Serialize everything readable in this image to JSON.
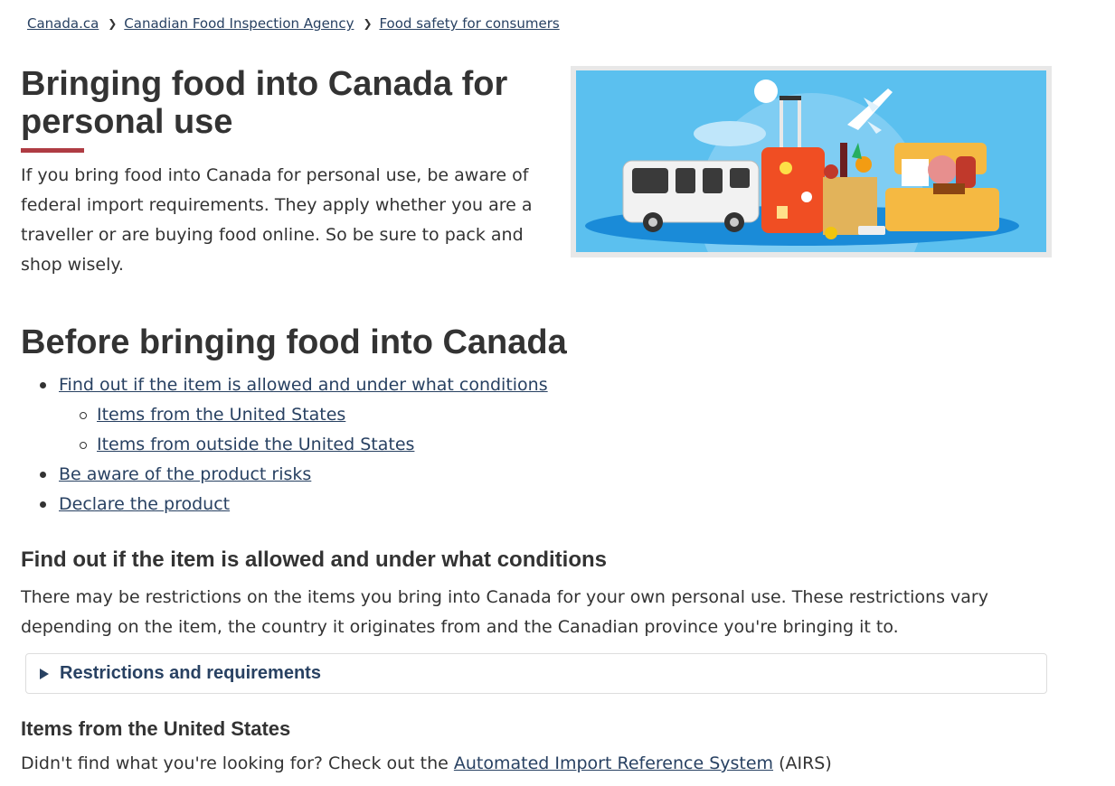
{
  "breadcrumb": [
    {
      "label": "Canada.ca"
    },
    {
      "label": "Canadian Food Inspection Agency"
    },
    {
      "label": "Food safety for consumers"
    }
  ],
  "intro": {
    "title": "Bringing food into Canada for personal use",
    "text": "If you bring food into Canada for personal use, be aware of federal import requirements. They apply whether you are a traveller or are buying food online. So be sure to pack and shop wisely.",
    "accent_color": "#af3c43"
  },
  "before": {
    "heading": "Before bringing food into Canada",
    "links": {
      "allowed": "Find out if the item is allowed and under what conditions",
      "us": "Items from the United States",
      "outside_us": "Items from outside the United States",
      "risks": "Be aware of the product risks",
      "declare": "Declare the product"
    }
  },
  "allowed_section": {
    "heading": "Find out if the item is allowed and under what conditions",
    "text": "There may be restrictions on the items you bring into Canada for your own personal use. These restrictions vary depending on the item, the country it originates from and the Canadian province you're bringing it to.",
    "details_summary": "Restrictions and requirements"
  },
  "us_section": {
    "heading": "Items from the United States",
    "text_before": "Didn't find what you're looking for? Check out the ",
    "link": "Automated Import Reference System",
    "text_after": " (AIRS)"
  },
  "colors": {
    "link": "#284162",
    "text": "#333333",
    "hero_sky": "#5bc0ef"
  }
}
